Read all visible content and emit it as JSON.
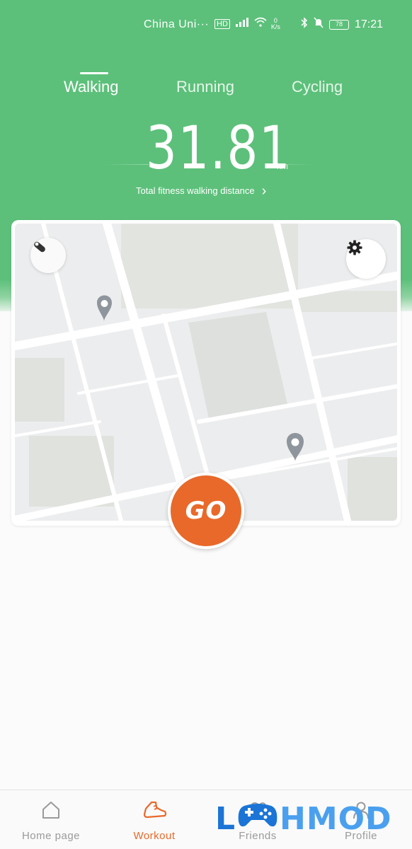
{
  "status_bar": {
    "carrier": "China Uni···",
    "hd_badge": "HD",
    "signal": "4G",
    "net_speed_value": "0",
    "net_speed_unit": "K/s",
    "battery": "78",
    "time": "17:21"
  },
  "tabs": [
    {
      "label": "Walking",
      "active": true
    },
    {
      "label": "Running",
      "active": false
    },
    {
      "label": "Cycling",
      "active": false
    }
  ],
  "distance": {
    "value": "31.81",
    "unit": "km",
    "caption": "Total fitness walking distance"
  },
  "map": {
    "left_button_icon": "location-toggle-icon",
    "right_button_icon": "gear-icon"
  },
  "go_button": {
    "label": "GO"
  },
  "bottom_nav": [
    {
      "label": "Home page",
      "icon": "home-icon",
      "active": false
    },
    {
      "label": "Workout",
      "icon": "shoe-icon",
      "active": true
    },
    {
      "label": "Friends",
      "icon": "friends-icon",
      "active": false
    },
    {
      "label": "Profile",
      "icon": "profile-icon",
      "active": false
    }
  ],
  "watermark": {
    "text_first": "L",
    "text_rest": "HMOD"
  },
  "colors": {
    "header_green": "#5cc07a",
    "accent_orange": "#e8692a",
    "map_background": "#ecedee",
    "watermark_blue": "#1b74d6"
  }
}
